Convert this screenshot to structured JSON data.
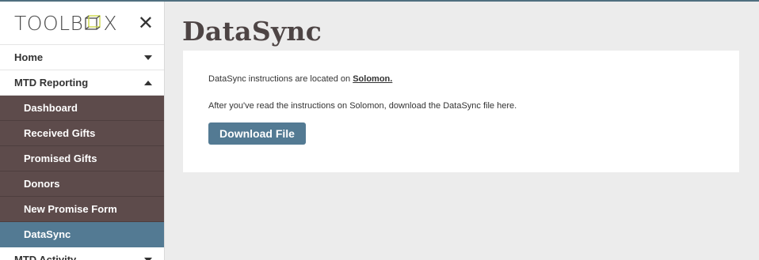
{
  "brand": {
    "logo_left": "TOOLB",
    "logo_right": "X",
    "close_glyph": "✕"
  },
  "sidebar": {
    "sections": [
      {
        "label": "Home",
        "caret": "down"
      },
      {
        "label": "MTD Reporting",
        "caret": "up"
      },
      {
        "label": "MTD Activity",
        "caret": "down"
      }
    ],
    "sub_items": [
      {
        "label": "Dashboard",
        "active": false
      },
      {
        "label": "Received Gifts",
        "active": false
      },
      {
        "label": "Promised Gifts",
        "active": false
      },
      {
        "label": "Donors",
        "active": false
      },
      {
        "label": "New Promise Form",
        "active": false
      },
      {
        "label": "DataSync",
        "active": true
      }
    ]
  },
  "main": {
    "title": "DataSync",
    "instructions_prefix": "DataSync instructions are located on ",
    "instructions_link": "Solomon.",
    "download_text": "After you've read the instructions on Solomon, download the DataSync file here.",
    "download_button": "Download File"
  },
  "colors": {
    "accent": "#537a93",
    "submenu_bg": "#5d4b4b",
    "title": "#4d4444",
    "page_bg": "#ececec"
  }
}
